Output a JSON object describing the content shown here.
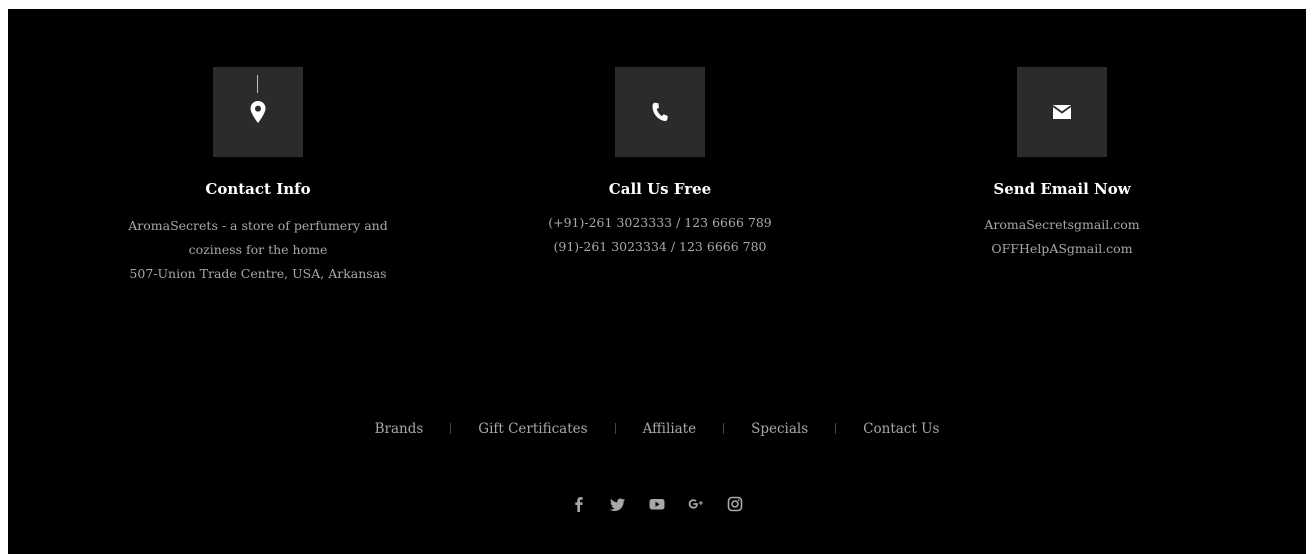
{
  "contact": {
    "title": "Contact Info",
    "lines": [
      "AromaSecrets - a store of perfumery and",
      "coziness for the home",
      "507-Union Trade Centre, USA, Arkansas"
    ],
    "icon": "location-pin-icon"
  },
  "call": {
    "title": "Call Us Free",
    "lines": [
      "(+91)-261 3023333 / 123 6666 789",
      "(91)-261 3023334 / 123 6666 780"
    ],
    "icon": "phone-icon"
  },
  "email": {
    "title": "Send Email Now",
    "lines": [
      "AromaSecretsgmail.com",
      "OFFHelpASgmail.com"
    ],
    "icon": "envelope-icon"
  },
  "links": [
    "Brands",
    "Gift Certificates",
    "Affiliate",
    "Specials",
    "Contact Us"
  ],
  "social": [
    "facebook-icon",
    "twitter-icon",
    "youtube-icon",
    "google-plus-icon",
    "instagram-icon"
  ],
  "colors": {
    "background": "#000000",
    "icon_box": "#2b2b2b",
    "heading": "#ffffff",
    "text": "#a8a8a8"
  }
}
